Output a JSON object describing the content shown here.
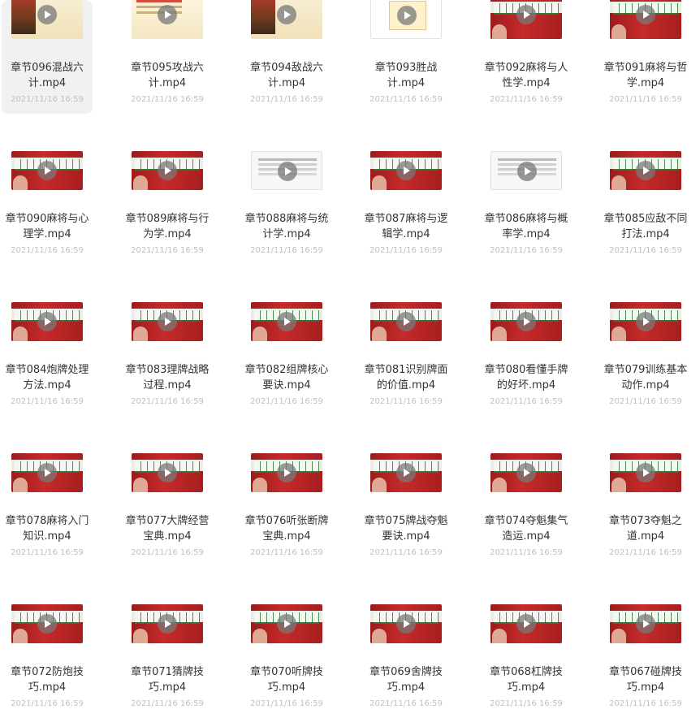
{
  "files": [
    {
      "line1": "章节096混战六",
      "line2": "计.mp4",
      "date": "2021/11/16 16:59",
      "thumb": "poster",
      "selected": true
    },
    {
      "line1": "章节095攻战六",
      "line2": "计.mp4",
      "date": "2021/11/16 16:59",
      "thumb": "poster2",
      "selected": false
    },
    {
      "line1": "章节094敌战六",
      "line2": "计.mp4",
      "date": "2021/11/16 16:59",
      "thumb": "poster",
      "selected": false
    },
    {
      "line1": "章节093胜战",
      "line2": "计.mp4",
      "date": "2021/11/16 16:59",
      "thumb": "paper",
      "selected": false
    },
    {
      "line1": "章节092麻将与人",
      "line2": "性学.mp4",
      "date": "2021/11/16 16:59",
      "thumb": "mahjong",
      "selected": false
    },
    {
      "line1": "章节091麻将与哲",
      "line2": "学.mp4",
      "date": "2021/11/16 16:59",
      "thumb": "mahjong",
      "selected": false
    },
    {
      "line1": "章节090麻将与心",
      "line2": "理学.mp4",
      "date": "2021/11/16 16:59",
      "thumb": "mahjong",
      "selected": false
    },
    {
      "line1": "章节089麻将与行",
      "line2": "为学.mp4",
      "date": "2021/11/16 16:59",
      "thumb": "mahjong",
      "selected": false
    },
    {
      "line1": "章节088麻将与统",
      "line2": "计学.mp4",
      "date": "2021/11/16 16:59",
      "thumb": "doc",
      "selected": false
    },
    {
      "line1": "章节087麻将与逻",
      "line2": "辑学.mp4",
      "date": "2021/11/16 16:59",
      "thumb": "mahjong",
      "selected": false
    },
    {
      "line1": "章节086麻将与概",
      "line2": "率学.mp4",
      "date": "2021/11/16 16:59",
      "thumb": "doc",
      "selected": false
    },
    {
      "line1": "章节085应敌不同",
      "line2": "打法.mp4",
      "date": "2021/11/16 16:59",
      "thumb": "mahjong",
      "selected": false
    },
    {
      "line1": "章节084炮牌处理",
      "line2": "方法.mp4",
      "date": "2021/11/16 16:59",
      "thumb": "mahjong",
      "selected": false
    },
    {
      "line1": "章节083理牌战略",
      "line2": "过程.mp4",
      "date": "2021/11/16 16:59",
      "thumb": "mahjong",
      "selected": false
    },
    {
      "line1": "章节082组牌核心",
      "line2": "要诀.mp4",
      "date": "2021/11/16 16:59",
      "thumb": "mahjong",
      "selected": false
    },
    {
      "line1": "章节081识别牌面",
      "line2": "的价值.mp4",
      "date": "2021/11/16 16:59",
      "thumb": "mahjong",
      "selected": false
    },
    {
      "line1": "章节080看懂手牌",
      "line2": "的好坏.mp4",
      "date": "2021/11/16 16:59",
      "thumb": "mahjong",
      "selected": false
    },
    {
      "line1": "章节079训练基本",
      "line2": "动作.mp4",
      "date": "2021/11/16 16:59",
      "thumb": "mahjong",
      "selected": false
    },
    {
      "line1": "章节078麻将入门",
      "line2": "知识.mp4",
      "date": "2021/11/16 16:59",
      "thumb": "mahjong",
      "selected": false
    },
    {
      "line1": "章节077大牌经营",
      "line2": "宝典.mp4",
      "date": "2021/11/16 16:59",
      "thumb": "mahjong",
      "selected": false
    },
    {
      "line1": "章节076听张断牌",
      "line2": "宝典.mp4",
      "date": "2021/11/16 16:59",
      "thumb": "mahjong",
      "selected": false
    },
    {
      "line1": "章节075牌战夺魁",
      "line2": "要诀.mp4",
      "date": "2021/11/16 16:59",
      "thumb": "mahjong",
      "selected": false
    },
    {
      "line1": "章节074夺魁集气",
      "line2": "造运.mp4",
      "date": "2021/11/16 16:59",
      "thumb": "mahjong",
      "selected": false
    },
    {
      "line1": "章节073夺魁之",
      "line2": "道.mp4",
      "date": "2021/11/16 16:59",
      "thumb": "mahjong",
      "selected": false
    },
    {
      "line1": "章节072防炮技",
      "line2": "巧.mp4",
      "date": "2021/11/16 16:59",
      "thumb": "mahjong",
      "selected": false
    },
    {
      "line1": "章节071猜牌技",
      "line2": "巧.mp4",
      "date": "2021/11/16 16:59",
      "thumb": "mahjong",
      "selected": false
    },
    {
      "line1": "章节070听牌技",
      "line2": "巧.mp4",
      "date": "2021/11/16 16:59",
      "thumb": "mahjong",
      "selected": false
    },
    {
      "line1": "章节069舍牌技",
      "line2": "巧.mp4",
      "date": "2021/11/16 16:59",
      "thumb": "mahjong",
      "selected": false
    },
    {
      "line1": "章节068杠牌技",
      "line2": "巧.mp4",
      "date": "2021/11/16 16:59",
      "thumb": "mahjong",
      "selected": false
    },
    {
      "line1": "章节067碰牌技",
      "line2": "巧.mp4",
      "date": "2021/11/16 16:59",
      "thumb": "mahjong",
      "selected": false
    }
  ]
}
